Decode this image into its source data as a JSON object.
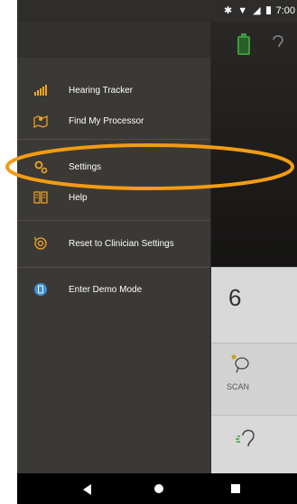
{
  "status_bar": {
    "time": "7:00",
    "icons": [
      "bluetooth-icon",
      "wifi-icon",
      "signal-icon",
      "battery-icon"
    ]
  },
  "menu": {
    "items": [
      {
        "label": "Hearing Tracker",
        "icon": "bar-chart-icon"
      },
      {
        "label": "Find My Processor",
        "icon": "map-icon"
      },
      {
        "label": "Settings",
        "icon": "gears-icon"
      },
      {
        "label": "Help",
        "icon": "book-icon"
      },
      {
        "label": "Reset to Clinician Settings",
        "icon": "reset-icon"
      },
      {
        "label": "Enter Demo Mode",
        "icon": "demo-icon"
      }
    ]
  },
  "background_app": {
    "program_number": "6",
    "scan_label": "SCAN"
  },
  "colors": {
    "accent": "#f5a623",
    "highlight_ring": "#f39c12",
    "drawer_bg": "#3b3936",
    "demo_icon": "#3a8fd6"
  }
}
